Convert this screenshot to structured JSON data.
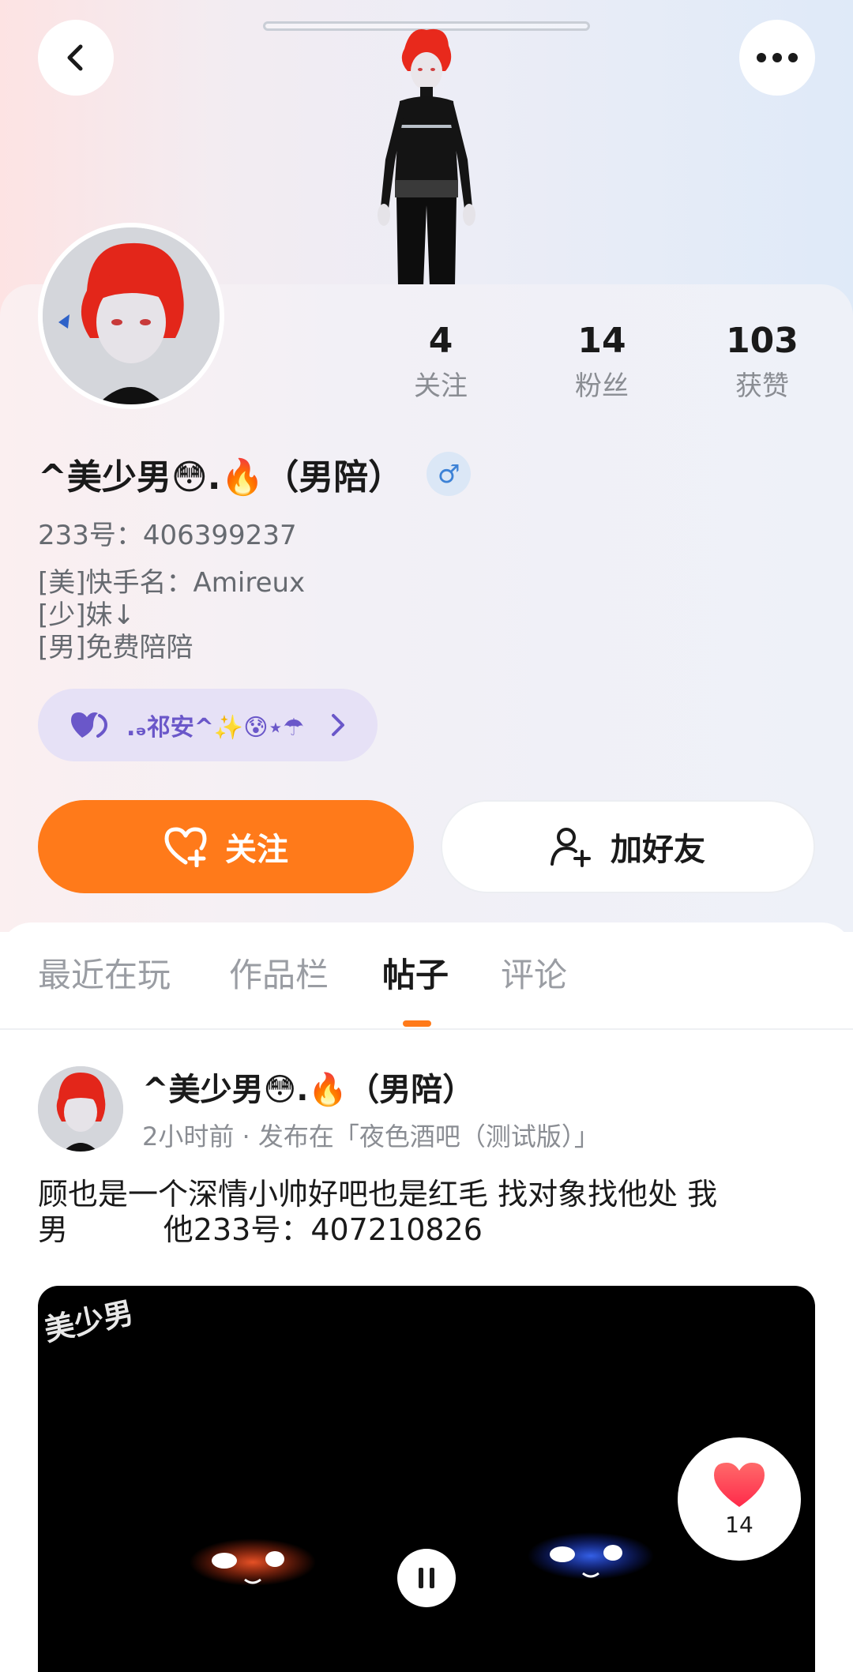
{
  "header": {
    "back_icon": "chevron-left-icon",
    "more_icon": "more-dots-icon"
  },
  "stats": [
    {
      "value": "4",
      "label": "关注"
    },
    {
      "value": "14",
      "label": "粉丝"
    },
    {
      "value": "103",
      "label": "获赞"
    }
  ],
  "profile": {
    "name": "^美少男😳.🔥（男陪）",
    "gender_symbol": "♂",
    "uid": "233号：406399237",
    "bio": [
      "[美]快手名：Amireux",
      "[少]妹↓",
      "[男]免费陪陪"
    ],
    "tag_label": ".ₔ祁安^✨😰⋆☂",
    "tag_icon": "heart-icon"
  },
  "actions": {
    "follow_label": "关注",
    "add_friend_label": "加好友"
  },
  "tabs": [
    {
      "label": "最近在玩",
      "active": false
    },
    {
      "label": "作品栏",
      "active": false
    },
    {
      "label": "帖子",
      "active": true
    },
    {
      "label": "评论",
      "active": false
    }
  ],
  "post": {
    "author": "^美少男😳.🔥（男陪）",
    "meta": "2小时前 · 发布在「夜色酒吧（测试版）」",
    "text_line1": "顾也是一个深情小帅好吧也是红毛 找对象找他处 我",
    "text_line2": "男          他233号：407210826",
    "video_watermark": "美少男",
    "like_count": "14"
  },
  "colors": {
    "accent": "#ff7a1a",
    "tag_text": "#6a57c9",
    "gender": "#3d82d6"
  }
}
